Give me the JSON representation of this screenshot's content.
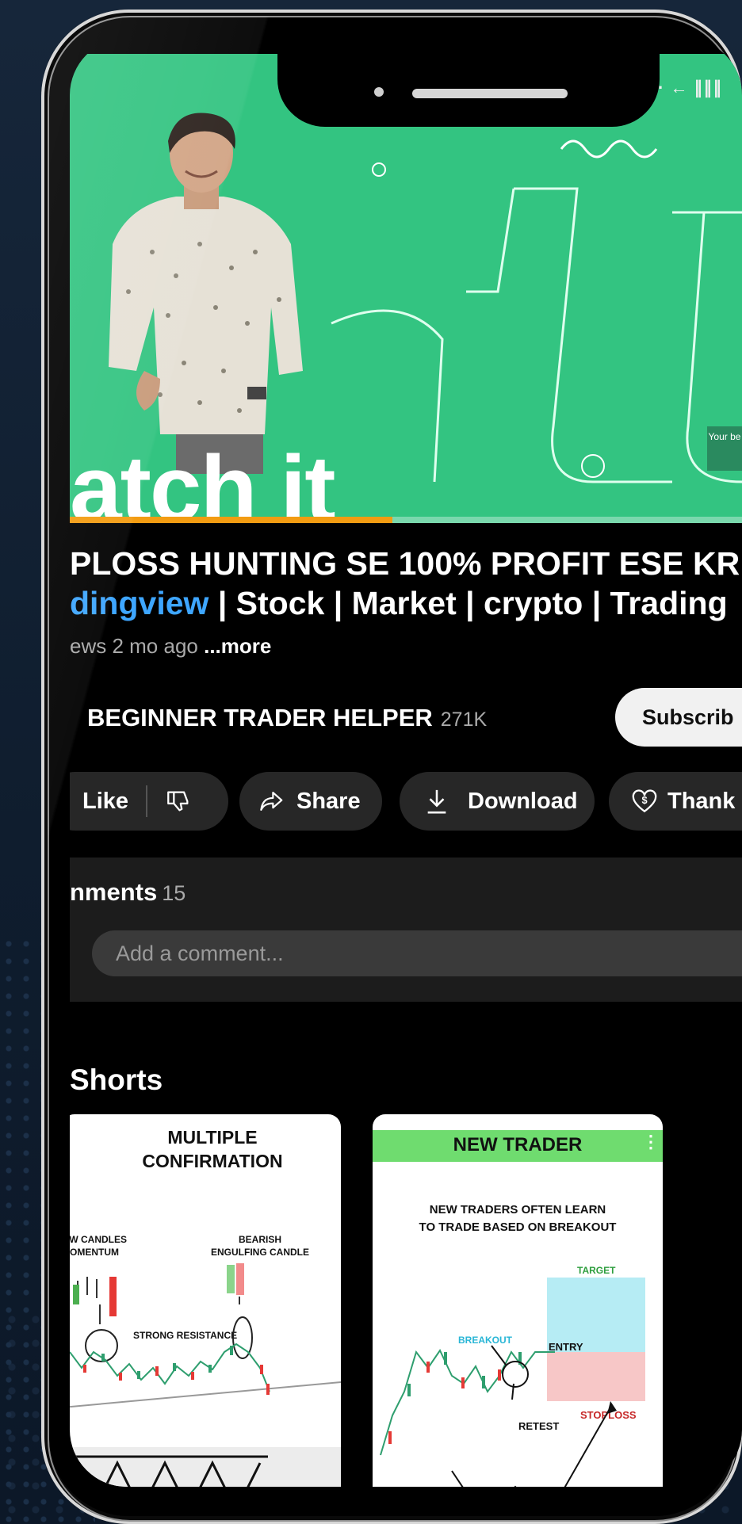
{
  "status_bar": {
    "icons": "· ← ∥∥∥"
  },
  "video": {
    "thumbnail_text": "atch it",
    "side_badge": "Your be",
    "progress_fraction": 0.48,
    "title": "PLOSS HUNTING SE 100% PROFIT ESE KR",
    "tags_highlight": "dingview",
    "tags_rest": " | Stock | Market | crypto | Trading",
    "meta_views": "ews  2 mo ago ",
    "meta_more": "...more"
  },
  "channel": {
    "name": "BEGINNER TRADER HELPER",
    "subscribers": "271K",
    "subscribe_label": "Subscrib"
  },
  "actions": {
    "like_label": "Like",
    "share_label": "Share",
    "download_label": "Download",
    "thanks_label": "Thank"
  },
  "comments": {
    "header": "nments",
    "count": "15",
    "placeholder": "Add a comment..."
  },
  "shorts": {
    "header": "Shorts",
    "cards": [
      {
        "title_line1": "MULTIPLE",
        "title_line2": "CONFIRMATION",
        "label_left_1": "OW CANDLES",
        "label_left_2": "MOMENTUM",
        "label_right_1": "BEARISH",
        "label_right_2": "ENGULFING CANDLE",
        "label_mid": "STRONG RESISTANCE"
      },
      {
        "banner": "NEW TRADER",
        "caption_1": "NEW TRADERS OFTEN LEARN",
        "caption_2": "TO TRADE BASED ON BREAKOUT",
        "target": "TARGET",
        "breakout": "BREAKOUT",
        "entry": "ENTRY",
        "stoploss": "STOPLOSS",
        "retest": "RETEST"
      }
    ]
  },
  "colors": {
    "thumbnail_green": "#33c481",
    "link_blue": "#3ea6ff",
    "progress_orange": "#f39c12",
    "banner_green": "#6fdc6f"
  }
}
